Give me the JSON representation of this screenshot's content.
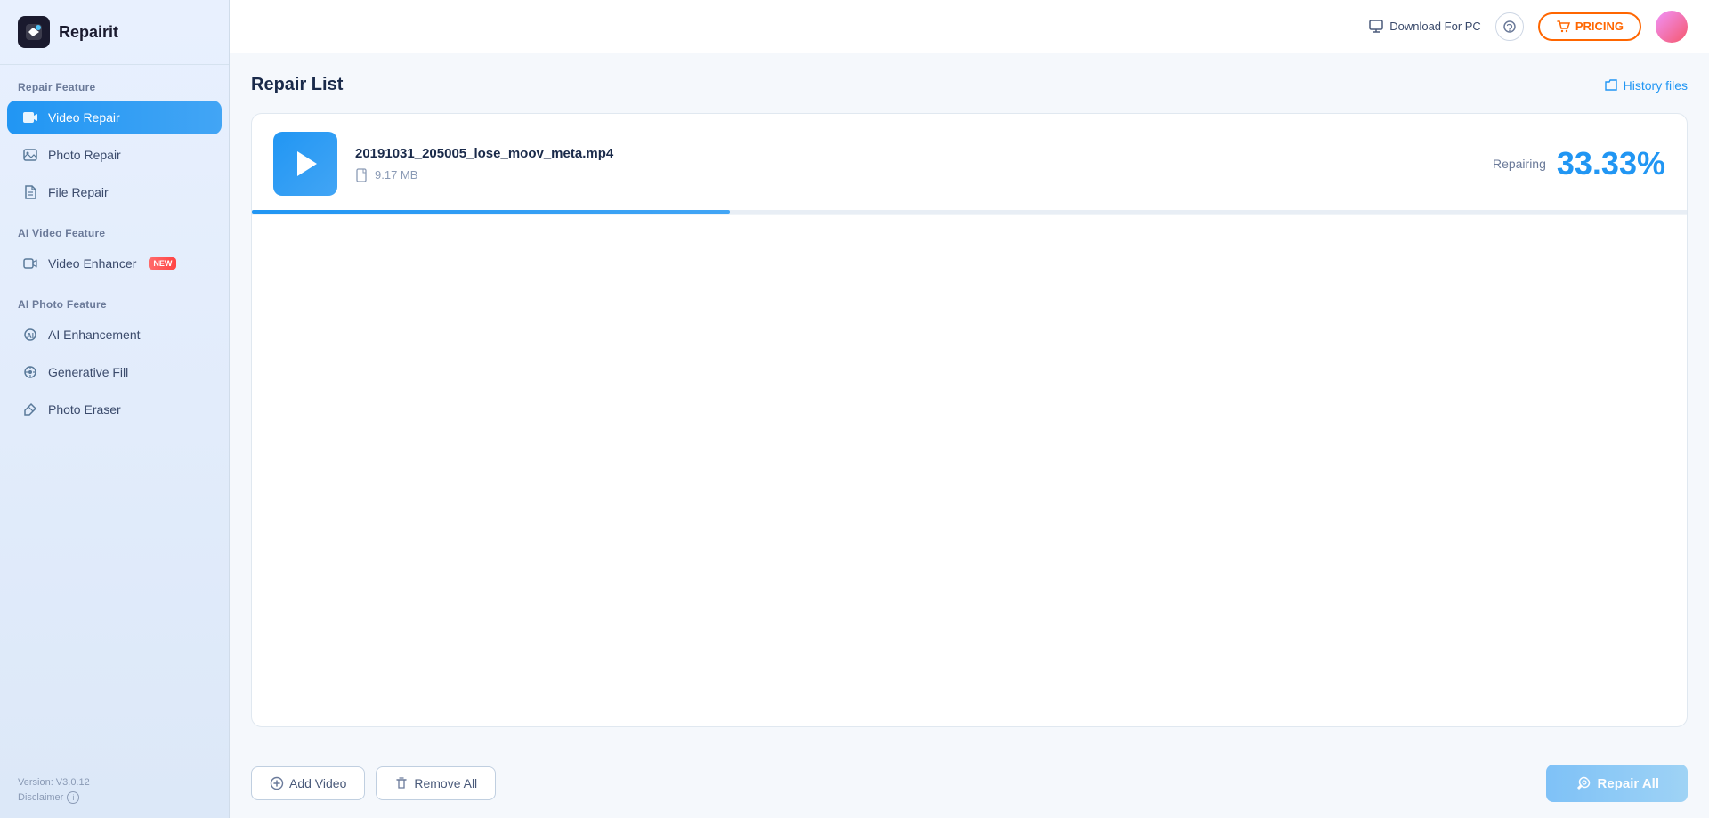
{
  "app": {
    "name": "Repairit"
  },
  "header": {
    "download_label": "Download For PC",
    "pricing_label": "PRICING",
    "history_label": "History files"
  },
  "sidebar": {
    "section_repair": "Repair Feature",
    "section_ai_video": "AI Video Feature",
    "section_ai_photo": "AI Photo Feature",
    "items": [
      {
        "id": "video-repair",
        "label": "Video Repair",
        "active": true
      },
      {
        "id": "photo-repair",
        "label": "Photo Repair",
        "active": false
      },
      {
        "id": "file-repair",
        "label": "File Repair",
        "active": false
      },
      {
        "id": "video-enhancer",
        "label": "Video Enhancer",
        "active": false,
        "badge": "NEW"
      },
      {
        "id": "ai-enhancement",
        "label": "AI Enhancement",
        "active": false
      },
      {
        "id": "generative-fill",
        "label": "Generative Fill",
        "active": false
      },
      {
        "id": "photo-eraser",
        "label": "Photo Eraser",
        "active": false
      }
    ],
    "version": "Version: V3.0.12",
    "disclaimer": "Disclaimer"
  },
  "repair_list": {
    "title": "Repair List",
    "files": [
      {
        "name": "20191031_205005_lose_moov_meta.mp4",
        "size": "9.17 MB",
        "status": "Repairing",
        "percent": "33.33%",
        "progress": 33.33
      }
    ]
  },
  "actions": {
    "add_video": "Add Video",
    "remove_all": "Remove All",
    "repair_all": "Repair All"
  }
}
